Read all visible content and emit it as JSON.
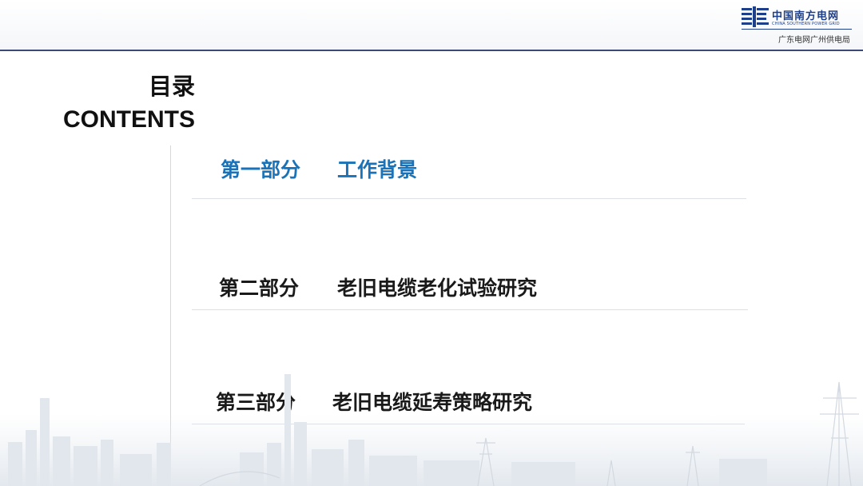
{
  "header": {
    "logo_cn": "中国南方电网",
    "logo_en": "CHINA SOUTHERN POWER GRID",
    "logo_sub": "广东电网广州供电局",
    "logo_icon": "grid-emblem-icon"
  },
  "title": {
    "cn": "目录",
    "en": "CONTENTS"
  },
  "toc": [
    {
      "part": "第一部分",
      "topic": "工作背景",
      "active": true
    },
    {
      "part": "第二部分",
      "topic": "老旧电缆老化试验研究",
      "active": false
    },
    {
      "part": "第三部分",
      "topic": "老旧电缆延寿策略研究",
      "active": false
    }
  ],
  "colors": {
    "accent": "#1a73b8",
    "header_rule": "#3d4a78",
    "brand": "#1e3f8a",
    "text": "#1a1a1a"
  }
}
